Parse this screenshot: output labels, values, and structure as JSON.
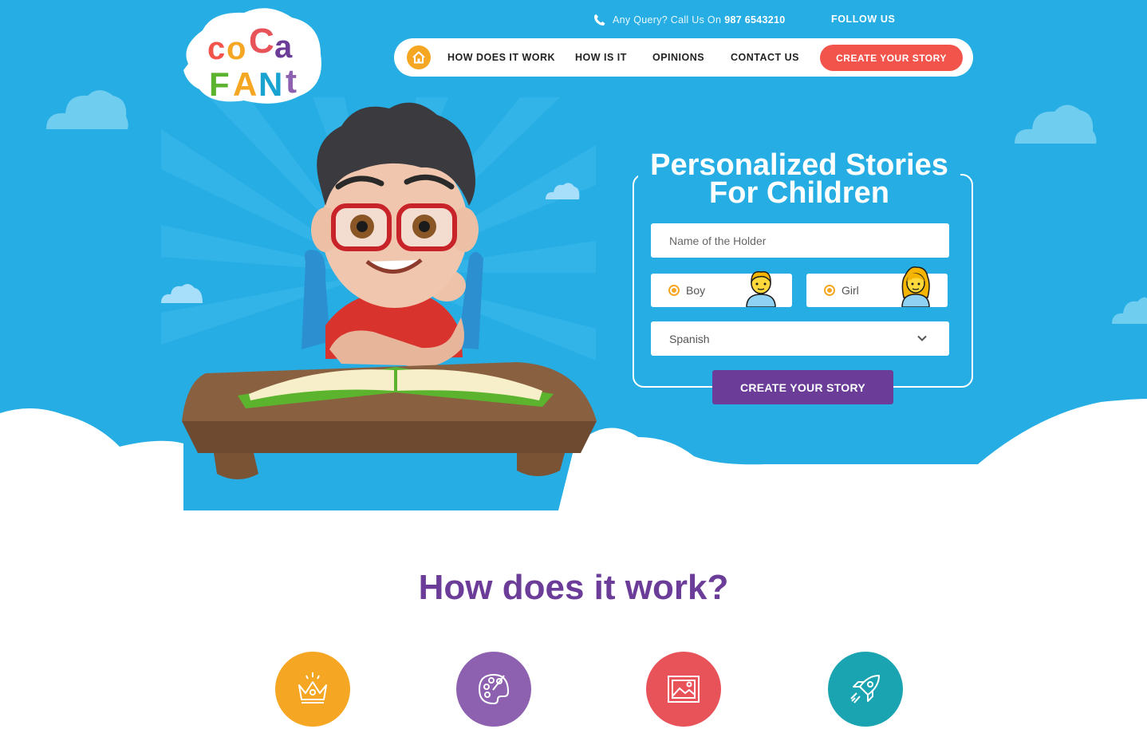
{
  "brand": {
    "name": "coco fant",
    "logo_letters": [
      "c",
      "o",
      "C",
      "a",
      "F",
      "A",
      "N",
      "t"
    ]
  },
  "topbar": {
    "query_text": "Any Query? Call Us On",
    "phone": "987 6543210",
    "follow": "FOLLOW US"
  },
  "nav": {
    "items": [
      "HOW DOES IT WORK",
      "HOW IS IT",
      "OPINIONS",
      "CONTACT US"
    ],
    "cta": "CREATE YOUR STORY"
  },
  "hero": {
    "title_line1": "Personalized Stories",
    "title_line2": "For Children"
  },
  "form": {
    "name_placeholder": "Name of the Holder",
    "boy_label": "Boy",
    "girl_label": "Girl",
    "language_selected": "Spanish",
    "submit_label": "CREATE YOUR STORY"
  },
  "how": {
    "title": "How does it work?",
    "steps": [
      {
        "icon": "crown-icon",
        "color": "#f5a623"
      },
      {
        "icon": "palette-icon",
        "color": "#8e61b0"
      },
      {
        "icon": "image-icon",
        "color": "#e8535a"
      },
      {
        "icon": "rocket-icon",
        "color": "#1aa3b0"
      }
    ]
  },
  "colors": {
    "sky": "#26aee4",
    "accent_red": "#f2534a",
    "purple": "#6b3d99",
    "orange": "#f5a623"
  }
}
